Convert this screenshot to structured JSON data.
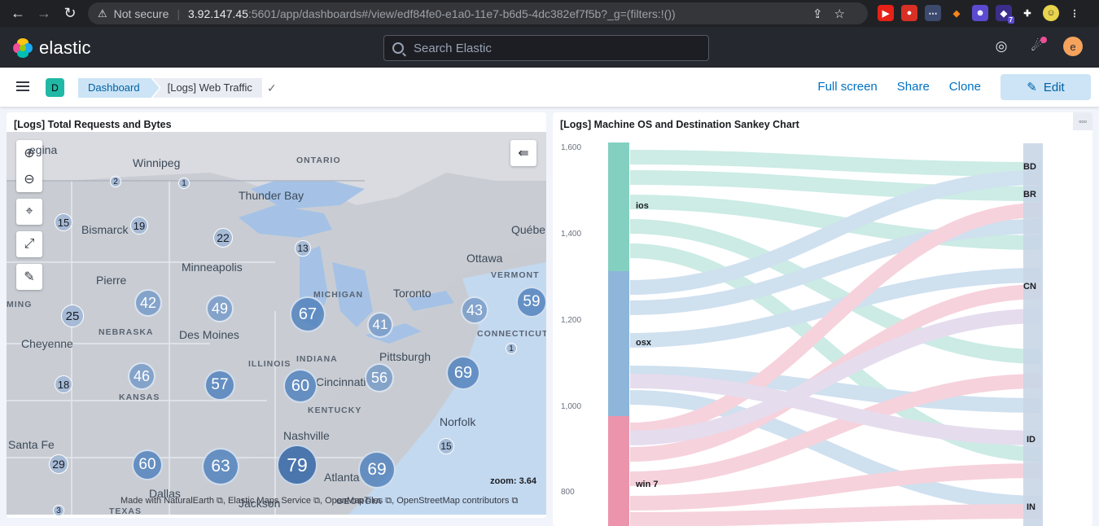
{
  "browser": {
    "security_label": "Not secure",
    "host": "3.92.147.45",
    "path": ":5601/app/dashboards#/view/edf84fe0-e1a0-11e7-b6d5-4dc382ef7f5b?_g=(filters:!())",
    "ext_badge": "7"
  },
  "header": {
    "brand": "elastic",
    "search_placeholder": "Search Elastic",
    "avatar_initial": "e"
  },
  "subnav": {
    "space_initial": "D",
    "breadcrumbs": [
      "Dashboard",
      "[Logs] Web Traffic"
    ],
    "actions": [
      "Full screen",
      "Share",
      "Clone"
    ],
    "edit_label": "Edit"
  },
  "map_panel": {
    "title": "[Logs] Total Requests and Bytes",
    "zoom_text": "zoom: 3.64",
    "attribution": "Made with NaturalEarth ⧉, Elastic Maps Service ⧉, OpenMapTiles ⧉, OpenStreetMap contributors ⧉",
    "places": [
      "egina",
      "Winnipeg",
      "Thunder Bay",
      "Bismarck",
      "Minneapolis",
      "Pierre",
      "Des Moines",
      "Cheyenne",
      "Pittsburgh",
      "Cincinnati",
      "Nashville",
      "Norfolk",
      "Santa Fe",
      "Atlanta",
      "Dallas",
      "Jackson",
      "Toronto",
      "Ottawa",
      "Québe"
    ],
    "states": [
      "ONTARIO",
      "MICHIGAN",
      "VERMONT",
      "NEBRASKA",
      "ILLINOIS",
      "INDIANA",
      "KANSAS",
      "KENTUCKY",
      "CONNECTICUT",
      "MING",
      "TEXAS",
      "GEORGIA"
    ],
    "clusters": [
      "2",
      "1",
      "15",
      "19",
      "22",
      "13",
      "42",
      "49",
      "67",
      "25",
      "41",
      "43",
      "59",
      "1",
      "46",
      "57",
      "60",
      "56",
      "69",
      "18",
      "15",
      "29",
      "60",
      "63",
      "79",
      "69",
      "3"
    ]
  },
  "sankey_panel": {
    "title": "[Logs] Machine OS and Destination Sankey Chart",
    "menu": "▫▫▫",
    "y_ticks": [
      "1,600",
      "1,400",
      "1,200",
      "1,000",
      "800"
    ],
    "sources": [
      "ios",
      "osx",
      "win 7"
    ],
    "targets": [
      "BD",
      "BR",
      "CN",
      "ID",
      "IN"
    ]
  },
  "colors": {
    "ios": "#6dc8b5",
    "osx": "#79a9d4",
    "win7": "#e8819d",
    "accent": "#0071c2"
  }
}
